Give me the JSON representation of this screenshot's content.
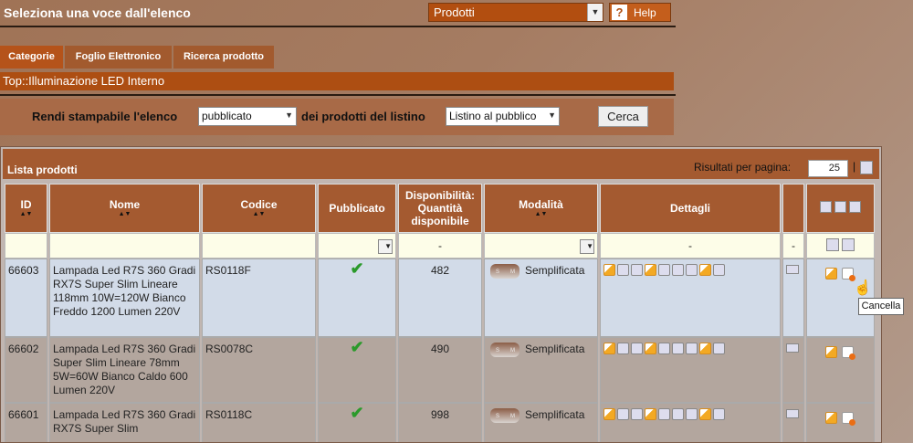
{
  "header": {
    "title": "Seleziona una voce dall'elenco",
    "select_value": "Prodotti",
    "help_label": "Help"
  },
  "tabs": [
    "Categorie",
    "Foglio Elettronico",
    "Ricerca prodotto"
  ],
  "breadcrumb": "Top::Illuminazione LED Interno",
  "filter": {
    "label1": "Rendi stampabile l'elenco",
    "select1_value": "pubblicato",
    "label2": "dei prodotti del listino",
    "select2_value": "Listino al pubblico",
    "search_label": "Cerca"
  },
  "list": {
    "title": "Lista prodotti",
    "results_per_page_label": "Risultati per pagina:",
    "results_per_page_value": "25",
    "separator": "|",
    "columns": {
      "id": "ID",
      "name": "Nome",
      "code": "Codice",
      "published": "Pubblicato",
      "availability": "Disponibilità: Quantità disponibile",
      "mode": "Modalità",
      "details": "Dettagli"
    },
    "filter_dash": "-",
    "rows": [
      {
        "id": "66603",
        "name": "Lampada Led R7S 360 Gradi RX7S Super Slim Lineare 118mm 10W=120W Bianco Freddo 1200 Lumen 220V",
        "code": "RS0118F",
        "qty": "482",
        "mode": "Semplificata"
      },
      {
        "id": "66602",
        "name": "Lampada Led R7S 360 Gradi Super Slim Lineare 78mm 5W=60W Bianco Caldo 600 Lumen 220V",
        "code": "RS0078C",
        "qty": "490",
        "mode": "Semplificata"
      },
      {
        "id": "66601",
        "name": "Lampada Led R7S 360 Gradi RX7S Super Slim",
        "code": "RS0118C",
        "qty": "998",
        "mode": "Semplificata"
      }
    ],
    "mode_pill_letters": [
      "S",
      "M"
    ],
    "tooltip": "Cancella"
  }
}
